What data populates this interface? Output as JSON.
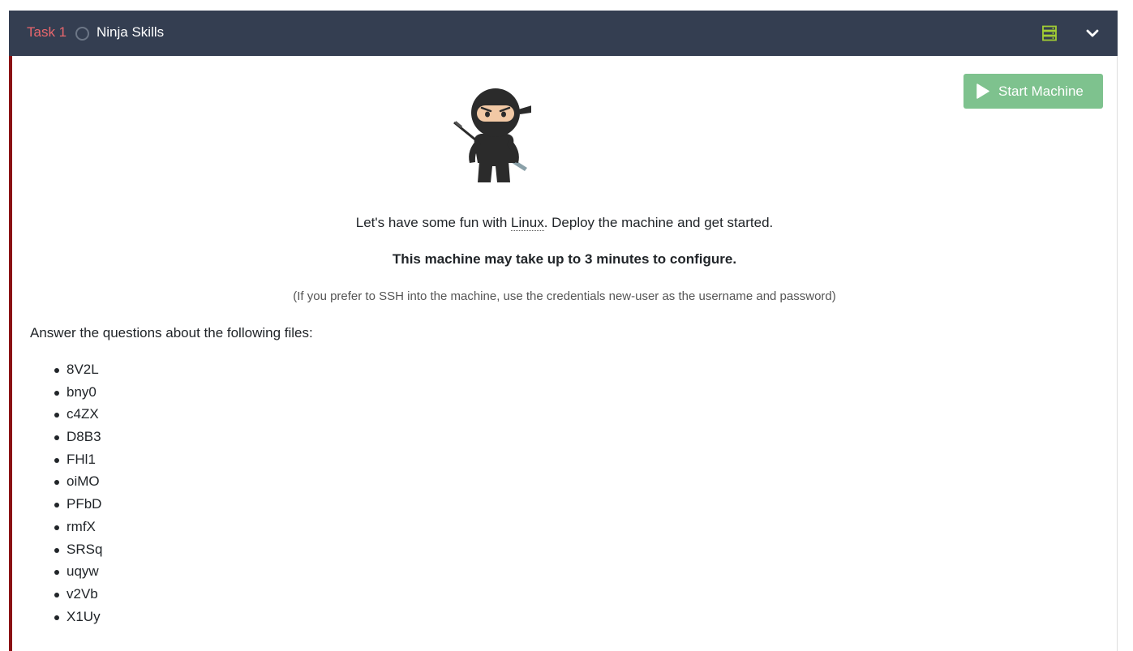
{
  "task": {
    "number_label": "Task 1",
    "title": "Ninja Skills"
  },
  "icons": {
    "status": "circle-outline-icon",
    "server": "server-icon",
    "expand": "chevron-down-icon",
    "play": "play-icon",
    "ninja": "ninja-image"
  },
  "colors": {
    "header_bg": "#343e51",
    "task_number": "#e9676d",
    "server_icon": "#a3ce33",
    "start_button": "#7ec28e",
    "left_border": "#8b1214"
  },
  "start_button": {
    "label": "Start Machine"
  },
  "content": {
    "intro_before": "Let's have some fun with ",
    "intro_link": "Linux",
    "intro_after": ". Deploy the machine and get started.",
    "bold_note": "This machine may take up to 3 minutes to configure.",
    "ssh_note": "(If you prefer to SSH into the machine, use the credentials new-user as the username and password)",
    "answer_prompt": "Answer the questions about the following files:"
  },
  "files": [
    "8V2L",
    "bny0",
    "c4ZX",
    "D8B3",
    "FHl1",
    "oiMO",
    "PFbD",
    "rmfX",
    "SRSq",
    "uqyw",
    "v2Vb",
    "X1Uy"
  ]
}
